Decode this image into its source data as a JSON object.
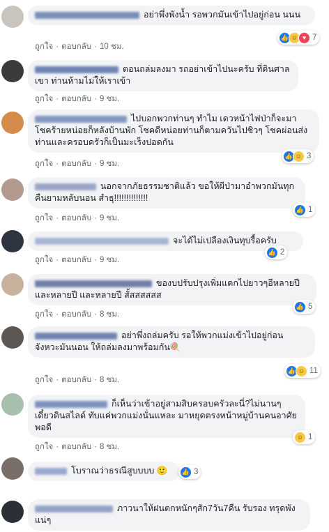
{
  "ui": {
    "like": "ถูกใจ",
    "reply": "ตอบกลับ",
    "dot": "·"
  },
  "comments": [
    {
      "text": "อย่าพึ่งพังน้ำ รอพวกมันเข้าไปอยู่ก่อน นนน",
      "time": "10 ชม.",
      "reactions": [
        "like",
        "haha",
        "love"
      ],
      "count": "7",
      "avatar_color": "#c9c4be",
      "name_color": "#7a8fb8"
    },
    {
      "text": "ตอนถล่มลงมา รถอย่าเข้าไปนะครับ ที่ดินศาลเขา ท่านห้ามไม่ให้เราเข้า",
      "time": "9 ชม.",
      "reactions": [],
      "count": "",
      "avatar_color": "#3b3b3b",
      "name_color": "#6e84b4"
    },
    {
      "text": "ไปบอกพวกท่านๆ ทำไม เดวหน้าไฟป่าก็จะมา โชคร้ายหน่อยก็หลังบ้านพัก โชคดีหน่อยท่านก็ตามควันไปชิวๆ โชคผ่อนส่งท่านและครอบครัวก็เป็นมะเร็งปอดกัน",
      "time": "9 ชม.",
      "reactions": [
        "like",
        "haha"
      ],
      "count": "3",
      "avatar_color": "#d58c4a",
      "name_color": "#8296bf"
    },
    {
      "text": "นอกจากภัยธรรมชาติแล้ว ขอให้ผีป่ามาอำพวกมันทุกคืนยามหลับนอน สำธุ!!!!!!!!!!!!!!",
      "time": "9 ชม.",
      "reactions": [
        "like"
      ],
      "count": "1",
      "avatar_color": "#b39a8e",
      "name_color": "#9aa6c9"
    },
    {
      "text": "จะได้ไม่เปลืองเงินทุบรื้อครับ",
      "time": "9 ชม.",
      "reactions": [
        "like"
      ],
      "count": "2",
      "avatar_color": "#2f3540",
      "name_color": "#a8b5d6"
    },
    {
      "text": "ของบปรับปรุงเพิ่มแดกไปยาวๆอีหลายปี และหลายปี และหลายปี สั้สสสสสส",
      "time": "8 ชม.",
      "reactions": [
        "like"
      ],
      "count": "5",
      "avatar_color": "#c9b29d",
      "name_color": "#6f7fa8"
    },
    {
      "text": "อย่าพึ่งถล่มครับ รอให้พวกแม่งเข้าไปอยู่ก่อน จังหวะมันนอน ให้ถล่มลงมาพร้อมกัน🍭",
      "time": "8 ชม.",
      "reactions": [
        "like",
        "haha"
      ],
      "count": "11",
      "avatar_color": "#5c5752",
      "name_color": "#7386b2"
    },
    {
      "text": "ก็เห็นว่าเข้าอยู่สามสิบครอบครัวละนี่?ไม่นานๆ เดี๋ยวดินสไลด์ ทับแค่พวกแม่งนั่นแหละ มาหยุดตรงหน้าหมู่บ้านคนอาศัยพอดี",
      "time": "8 ชม.",
      "reactions": [
        "haha"
      ],
      "count": "1",
      "avatar_color": "#a9bfae",
      "name_color": "#7f93c2"
    },
    {
      "text": "โบราณว่าธรณีสูบบบบ 🙂",
      "time": "",
      "reactions": [
        "like"
      ],
      "count": "3",
      "avatar_color": "#7a6e68",
      "name_color": "#9aa8cf"
    },
    {
      "text": "ภาวนาให้ฝนตกหนักๆสัก7วัน7คืน รับรอง ทรุดพังแน่ๆ",
      "time": "",
      "reactions": [],
      "count": "",
      "avatar_color": "#2c2f36",
      "name_color": "#95a3c8"
    }
  ]
}
